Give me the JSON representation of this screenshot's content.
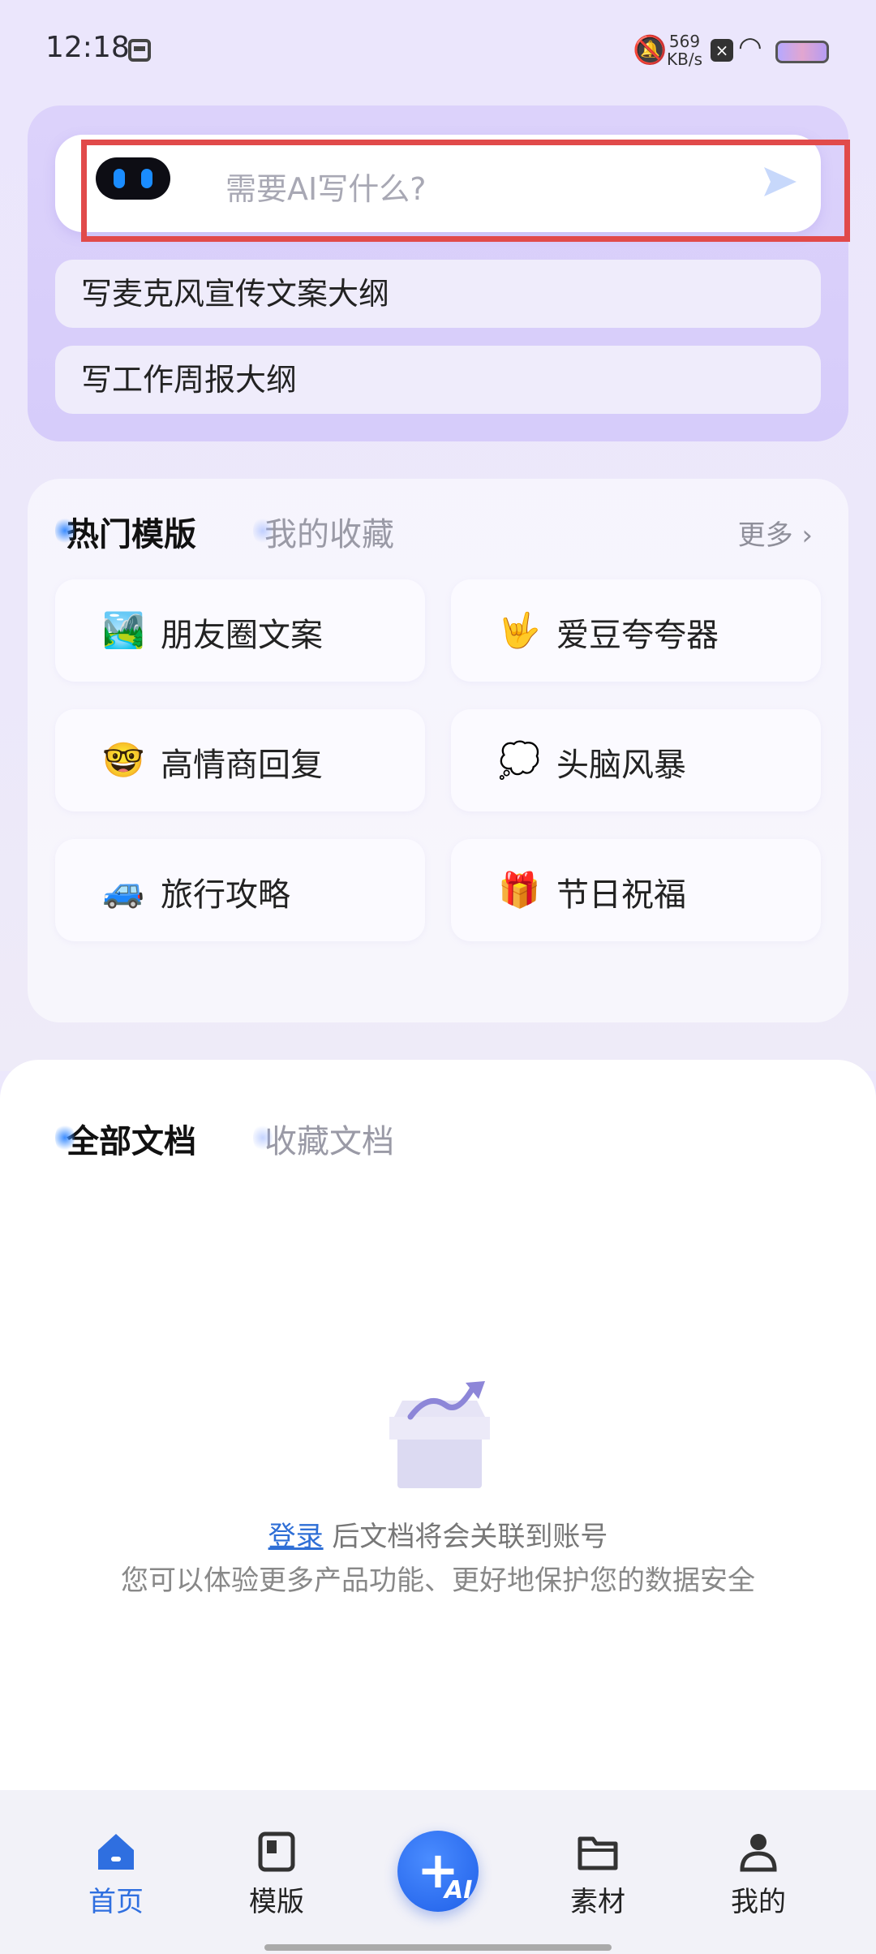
{
  "status_bar": {
    "time": "12:18",
    "net_speed_value": "569",
    "net_speed_unit": "KB/s"
  },
  "ai_box": {
    "placeholder": "需要AI写什么?",
    "suggestions": [
      "写麦克风宣传文案大纲",
      "写工作周报大纲"
    ]
  },
  "templates": {
    "tabs": [
      "热门模版",
      "我的收藏"
    ],
    "more_label": "更多 ›",
    "items": [
      {
        "icon": "🏞️",
        "label": "朋友圈文案"
      },
      {
        "icon": "🤟",
        "label": "爱豆夸夸器"
      },
      {
        "icon": "🤓",
        "label": "高情商回复"
      },
      {
        "icon": "💭",
        "label": "头脑风暴"
      },
      {
        "icon": "🚙",
        "label": "旅行攻略"
      },
      {
        "icon": "🎁",
        "label": "节日祝福"
      }
    ]
  },
  "documents": {
    "tabs": [
      "全部文档",
      "收藏文档"
    ],
    "empty_link": "登录",
    "empty_text": " 后文档将会关联到账号",
    "empty_sub": "您可以体验更多产品功能、更好地保护您的数据安全"
  },
  "nav": {
    "items": [
      {
        "label": "首页",
        "icon": "home-icon"
      },
      {
        "label": "模版",
        "icon": "template-icon"
      },
      {
        "label": "素材",
        "icon": "folder-icon"
      },
      {
        "label": "我的",
        "icon": "profile-icon"
      }
    ],
    "fab_label": "AI"
  },
  "colors": {
    "accent": "#2f6fe0",
    "highlight_box": "#e14a4a",
    "card_lavender": "#d8cefa"
  }
}
